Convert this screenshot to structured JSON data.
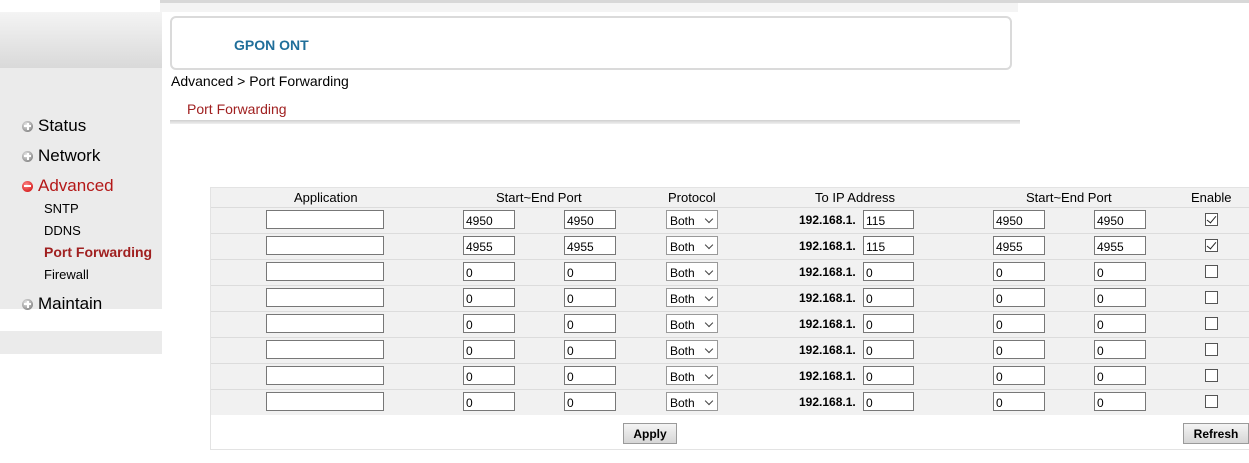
{
  "header": {
    "title": "GPON ONT"
  },
  "sidebar": {
    "items": [
      {
        "label": "Status",
        "icon": "plus-circle-icon"
      },
      {
        "label": "Network",
        "icon": "plus-circle-icon"
      },
      {
        "label": "Advanced",
        "icon": "minus-circle-icon",
        "active": true,
        "children": [
          "SNTP",
          "DDNS",
          "Port Forwarding",
          "Firewall"
        ]
      },
      {
        "label": "Maintain",
        "icon": "plus-circle-icon"
      }
    ]
  },
  "breadcrumb": "Advanced > Port Forwarding",
  "page_tab": "Port Forwarding",
  "table": {
    "headers": {
      "application": "Application",
      "start_end_port": "Start~End Port",
      "protocol": "Protocol",
      "to_ip": "To IP Address",
      "start_end_port_2": "Start~End Port",
      "enable": "Enable"
    },
    "ip_prefix": "192.168.1.",
    "rows": [
      {
        "application": "",
        "start1": "4950",
        "end1": "4950",
        "protocol": "Both",
        "ip_last": "115",
        "start2": "4950",
        "end2": "4950",
        "enabled": true
      },
      {
        "application": "",
        "start1": "4955",
        "end1": "4955",
        "protocol": "Both",
        "ip_last": "115",
        "start2": "4955",
        "end2": "4955",
        "enabled": true
      },
      {
        "application": "",
        "start1": "0",
        "end1": "0",
        "protocol": "Both",
        "ip_last": "0",
        "start2": "0",
        "end2": "0",
        "enabled": false
      },
      {
        "application": "",
        "start1": "0",
        "end1": "0",
        "protocol": "Both",
        "ip_last": "0",
        "start2": "0",
        "end2": "0",
        "enabled": false
      },
      {
        "application": "",
        "start1": "0",
        "end1": "0",
        "protocol": "Both",
        "ip_last": "0",
        "start2": "0",
        "end2": "0",
        "enabled": false
      },
      {
        "application": "",
        "start1": "0",
        "end1": "0",
        "protocol": "Both",
        "ip_last": "0",
        "start2": "0",
        "end2": "0",
        "enabled": false
      },
      {
        "application": "",
        "start1": "0",
        "end1": "0",
        "protocol": "Both",
        "ip_last": "0",
        "start2": "0",
        "end2": "0",
        "enabled": false
      },
      {
        "application": "",
        "start1": "0",
        "end1": "0",
        "protocol": "Both",
        "ip_last": "0",
        "start2": "0",
        "end2": "0",
        "enabled": false
      }
    ]
  },
  "buttons": {
    "apply": "Apply",
    "refresh": "Refresh"
  },
  "colors": {
    "accent": "#1f6e9a",
    "active": "#b41818"
  }
}
